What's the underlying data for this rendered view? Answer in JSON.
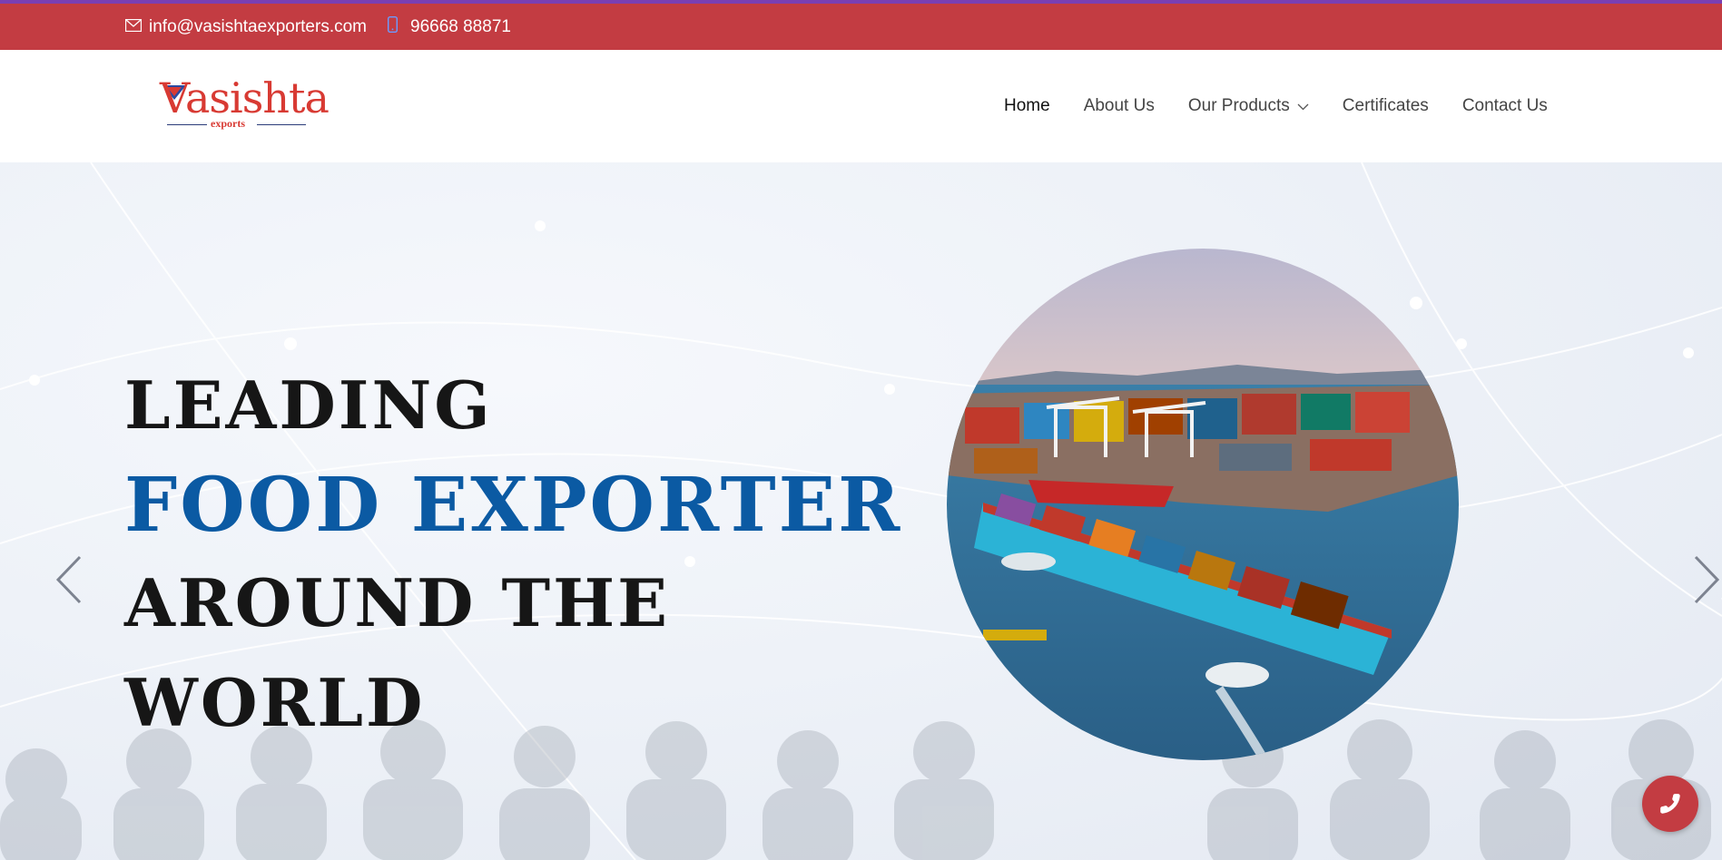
{
  "topbar": {
    "email": "info@vasishtaexporters.com",
    "phone": "96668 88871",
    "email_icon": "envelope-icon",
    "phone_icon": "mobile-phone-icon"
  },
  "header": {
    "logo": {
      "main": "Vasishta",
      "sub": "exports"
    },
    "nav": [
      {
        "label": "Home",
        "active": true
      },
      {
        "label": "About Us"
      },
      {
        "label": "Our Products",
        "has_dropdown": true
      },
      {
        "label": "Certificates"
      },
      {
        "label": "Contact Us"
      }
    ]
  },
  "hero": {
    "line1": "LEADING",
    "line2": "FOOD EXPORTER",
    "line3": "AROUND THE",
    "line4": "WORLD",
    "image": "container-ship-port-photo",
    "prev_icon": "chevron-left-icon",
    "next_icon": "chevron-right-icon"
  },
  "floating": {
    "call_icon": "phone-icon"
  },
  "colors": {
    "topbar": "#c33c42",
    "accent_blue": "#0b5aa3",
    "brand_red": "#d83a33",
    "top_border": "#7a3fb3"
  }
}
